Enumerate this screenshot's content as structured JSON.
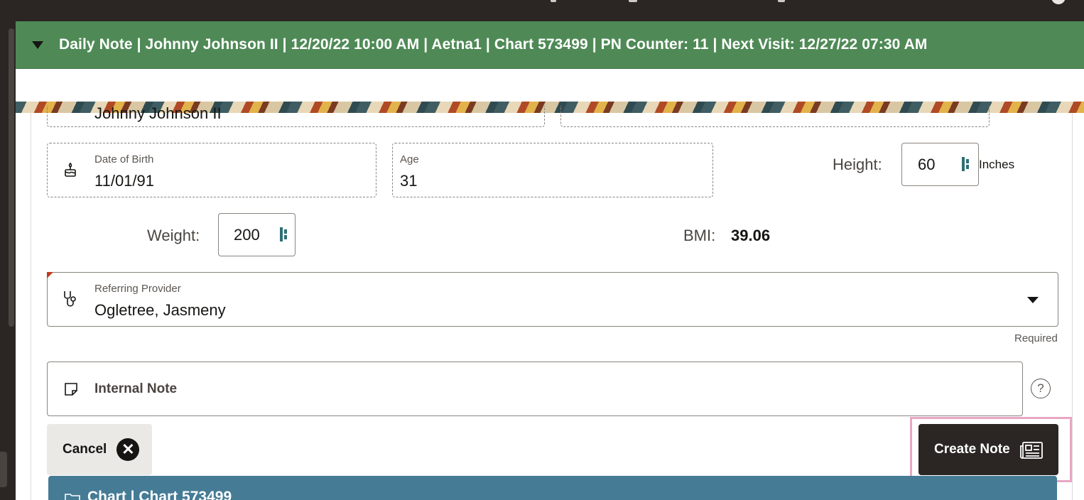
{
  "banner": {
    "title": "Daily Note | Johnny Johnson II | 12/20/22 10:00 AM | Aetna1 | Chart 573499 | PN Counter: 11 | Next Visit: 12/27/22 07:30 AM"
  },
  "patient_name_value": "Johnny Johnson II",
  "dob": {
    "label": "Date of Birth",
    "value": "11/01/91",
    "icon": "cake-icon"
  },
  "age": {
    "label": "Age",
    "value": "31"
  },
  "height": {
    "label": "Height:",
    "value": "60",
    "unit": "Inches"
  },
  "weight": {
    "label": "Weight:",
    "value": "200"
  },
  "bmi": {
    "label": "BMI:",
    "value": "39.06"
  },
  "referring_provider": {
    "label": "Referring Provider",
    "value": "Ogletree, Jasmeny",
    "helper": "Required",
    "icon": "stethoscope-icon"
  },
  "internal_note": {
    "placeholder": "Internal Note",
    "icon": "sticky-note-icon"
  },
  "help_icon": "?",
  "actions": {
    "cancel": "Cancel",
    "create_note": "Create Note"
  },
  "chart_section": {
    "title": "Chart | Chart 573499"
  },
  "colors": {
    "banner": "#4f8a56",
    "chart_bar": "#457b95",
    "dark_button": "#2b2623",
    "highlight": "#e9a6c3",
    "required_marker": "#c0391f"
  }
}
